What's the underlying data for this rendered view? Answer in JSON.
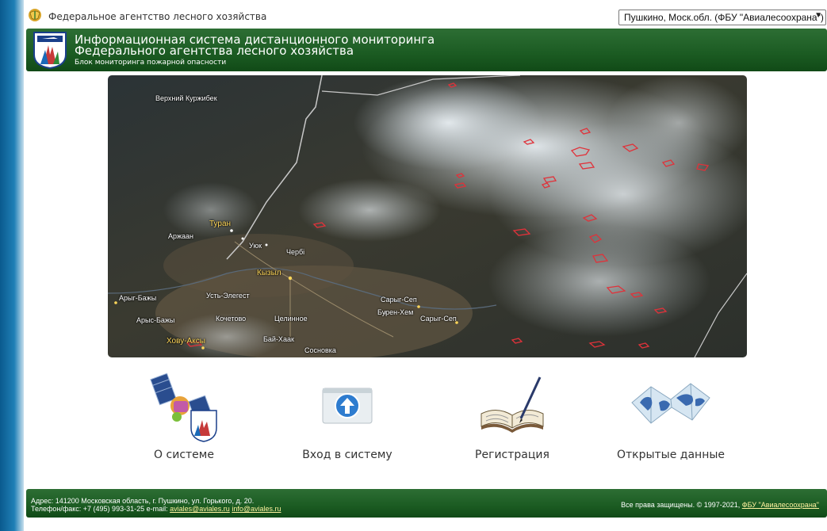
{
  "topbar": {
    "agency_name": "Федеральное агентство лесного хозяйства",
    "region_selected": "Пушкино, Моск.обл. (ФБУ \"Авиалесоохрана\")"
  },
  "header": {
    "title_line1": "Информационная система дистанционного мониторинга",
    "title_line2": "Федерального агентства лесного хозяйства",
    "subtitle": "Блок мониторинга пожарной опасности"
  },
  "map": {
    "labels": {
      "verkhniy": "Верхний Куржибек",
      "turan": "Туран",
      "arzhaan": "Аржаан",
      "uyuk": "Уюк",
      "churbi": "Чербі",
      "kyzyl": "Кызыл",
      "aryg_bazhy": "Арыг-Бажы",
      "ust_elegest": "Усть-Элегест",
      "kochetovo": "Кочетово",
      "tselinnoe": "Целинное",
      "saryg_sep1": "Сарыг-Сеп",
      "buren_khem": "Бурен-Хем",
      "saryg_sep2": "Сарыг-Сеп",
      "arys_bazhy": "Арыс-Бажы",
      "khovu_aksy": "Хову-Аксы",
      "bay_khaak": "Бай-Хаак",
      "sosnovka": "Сосновка"
    }
  },
  "menu": [
    {
      "label": "О системе",
      "icon": "satellite-icon"
    },
    {
      "label": "Вход в систему",
      "icon": "login-arrow-icon"
    },
    {
      "label": "Регистрация",
      "icon": "book-pen-icon"
    },
    {
      "label": "Открытые данные",
      "icon": "world-map-icon"
    }
  ],
  "footer": {
    "address": "Адрес: 141200 Московская область, г. Пушкино, ул. Горького, д. 20.",
    "phone": "Телефон/факс: +7 (495) 993-31-25",
    "email_label": "e-mail:",
    "email1": "aviales@aviales.ru",
    "email2": "info@aviales.ru",
    "rights": "Все права защищены. © 1997-2021,",
    "rights_link": "ФБУ \"Авиалесоохрана\""
  },
  "colors": {
    "header_green": "#1b5b22",
    "link_yellow": "#fff3a0",
    "fire_red": "#e0323a"
  }
}
